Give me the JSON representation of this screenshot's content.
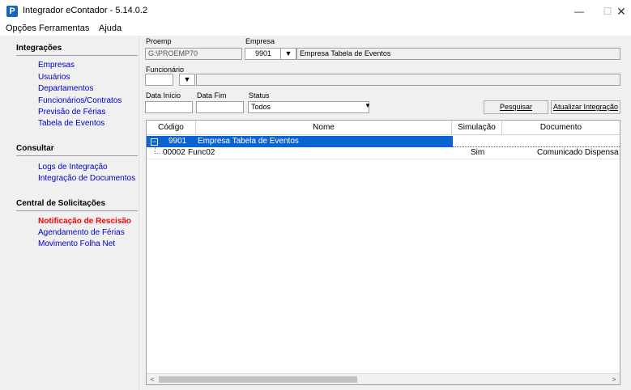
{
  "window": {
    "title": "Integrador eContador - 5.14.0.2",
    "app_icon": "P",
    "minimize_glyph": "—",
    "maximize_glyph": "☐",
    "close_glyph": "✕"
  },
  "menu": [
    "Opções",
    "Ferramentas",
    "Ajuda"
  ],
  "sidebar": {
    "sections": [
      {
        "title": "Integrações",
        "items": [
          "Empresas",
          "Usuários",
          "Departamentos",
          "Funcionários/Contratos",
          "Previsão de Férias",
          "Tabela de Eventos"
        ]
      },
      {
        "title": "Consultar",
        "items": [
          "Logs de Integração",
          "Integração de Documentos"
        ]
      },
      {
        "title": "Central de Solicitações",
        "items": [
          "Notificação de Rescisão",
          "Agendamento de Férias",
          "Movimento Folha Net"
        ]
      }
    ],
    "active_item": "Notificação de Rescisão",
    "active_color": "#ff0000",
    "link_color": "#0000cc"
  },
  "form": {
    "proemp_label": "Proemp",
    "proemp_value": "G:\\PROEMP70",
    "empresa_label": "Empresa",
    "empresa_code": "9901",
    "empresa_name": "Empresa Tabela de Eventos",
    "funcionario_label": "Funcionário",
    "funcionario_value": "",
    "data_inicio_label": "Data Início",
    "data_inicio_value": "",
    "data_fim_label": "Data Fim",
    "data_fim_value": "",
    "status_label": "Status",
    "status_value": "Todos",
    "pesquisar_label": "Pesquisar",
    "atualizar_label": "Atualizar Integração",
    "dropdown_glyph": "▼"
  },
  "grid": {
    "columns": [
      "Código",
      "Nome",
      "Simulação",
      "Documento"
    ],
    "rows": [
      {
        "codigo": "9901",
        "nome": "Empresa Tabela de Eventos",
        "simulacao": "",
        "documento": "",
        "selected": true,
        "expand": "−"
      },
      {
        "codigo": "00002",
        "nome": "Func02",
        "simulacao": "Sim",
        "documento": "Comunicado Dispensa",
        "selected": false
      }
    ],
    "selection_color": "#0a64d6",
    "scroll_left": "<",
    "scroll_right": ">"
  }
}
